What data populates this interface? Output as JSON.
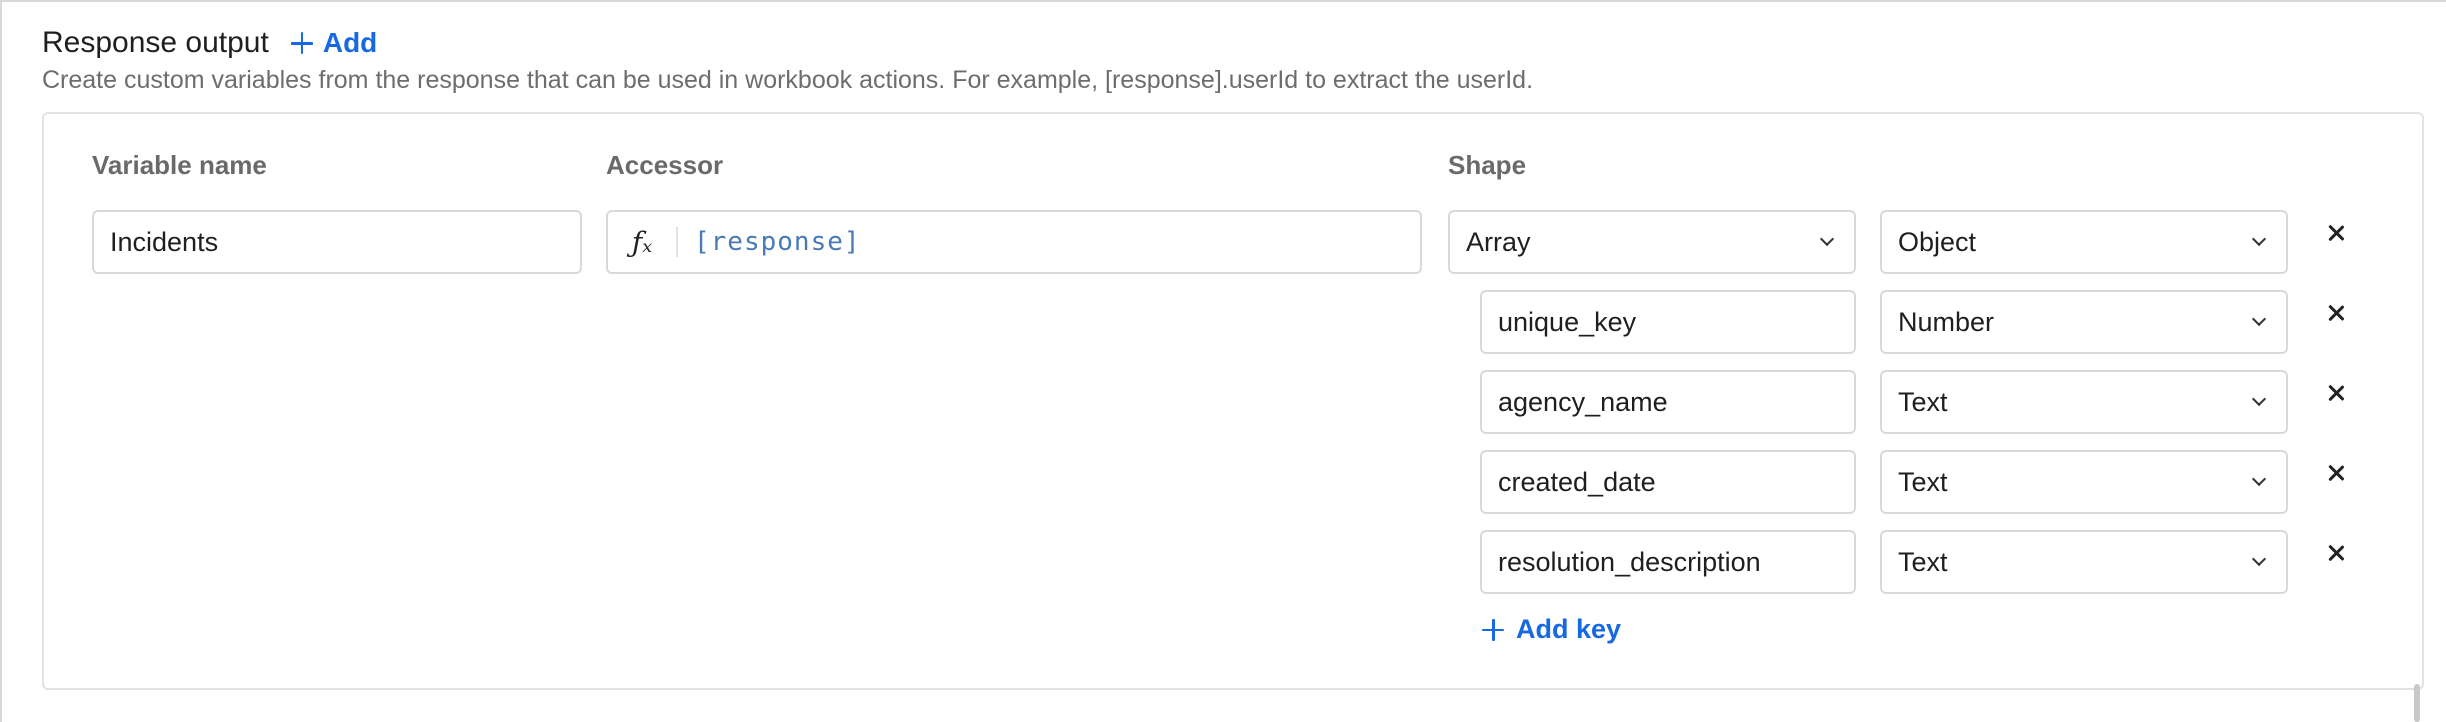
{
  "section": {
    "title": "Response output",
    "add_label": "Add",
    "description": "Create custom variables from the response that can be used in workbook actions. For example, [response].userId to extract the userId."
  },
  "columns": {
    "variable_name": "Variable name",
    "accessor": "Accessor",
    "shape": "Shape"
  },
  "variable": {
    "name": "Incidents",
    "accessor_icon": "fx-icon",
    "accessor": "[response]",
    "shape_type": "Array",
    "shape_item_type": "Object"
  },
  "keys": [
    {
      "name": "unique_key",
      "type": "Number"
    },
    {
      "name": "agency_name",
      "type": "Text"
    },
    {
      "name": "created_date",
      "type": "Text"
    },
    {
      "name": "resolution_description",
      "type": "Text"
    }
  ],
  "add_key_label": "Add key",
  "colors": {
    "accent": "#1668e3",
    "code": "#4a7ab5",
    "muted_text": "#6d6d6d"
  }
}
